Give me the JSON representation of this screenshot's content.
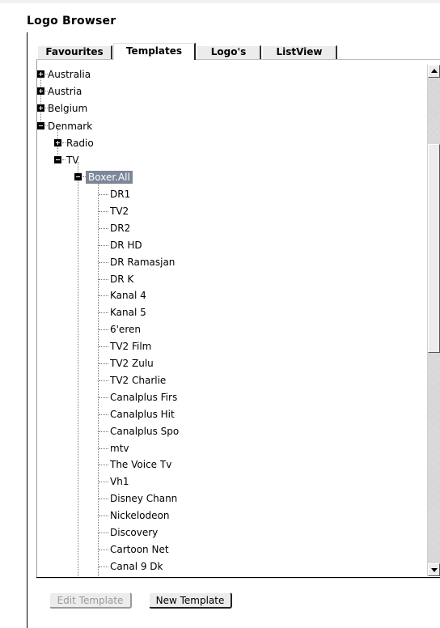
{
  "window": {
    "title": "Logo Browser"
  },
  "tabs": [
    {
      "label": "Favourites",
      "active": false
    },
    {
      "label": "Templates",
      "active": true
    },
    {
      "label": "Logo's",
      "active": false
    },
    {
      "label": "ListView",
      "active": false
    }
  ],
  "tree": {
    "countries": [
      {
        "label": "Australia",
        "expanded": false
      },
      {
        "label": "Austria",
        "expanded": false
      },
      {
        "label": "Belgium",
        "expanded": false
      },
      {
        "label": "Denmark",
        "expanded": true
      }
    ],
    "denmark_children": [
      {
        "label": "Radio",
        "expanded": false
      },
      {
        "label": "TV",
        "expanded": true
      }
    ],
    "tv_children": [
      {
        "label": "Boxer.All",
        "expanded": true,
        "selected": true
      }
    ],
    "channels": [
      "DR1",
      "TV2",
      "DR2",
      "DR HD",
      "DR Ramasjan",
      "DR K",
      "Kanal 4",
      "Kanal 5",
      "6'eren",
      "TV2 Film",
      "TV2 Zulu",
      "TV2 Charlie",
      "Canalplus Firs",
      "Canalplus Hit",
      "Canalplus Spo",
      "mtv",
      "The Voice Tv",
      "Vh1",
      "Disney Chann",
      "Nickelodeon",
      "Discovery",
      "Cartoon Net",
      "Canal 9 Dk"
    ]
  },
  "buttons": {
    "edit_template": {
      "label": "Edit Template",
      "enabled": false
    },
    "new_template": {
      "label": "New Template",
      "enabled": true
    }
  },
  "icons": {
    "expand": "plus-box-icon",
    "collapse": "minus-box-icon",
    "scroll_up": "triangle-up-icon",
    "scroll_down": "triangle-down-icon"
  },
  "colors": {
    "selection": "#7d8797",
    "tab_inactive": "#ececec",
    "button_disabled_text": "#9a9a9a"
  }
}
